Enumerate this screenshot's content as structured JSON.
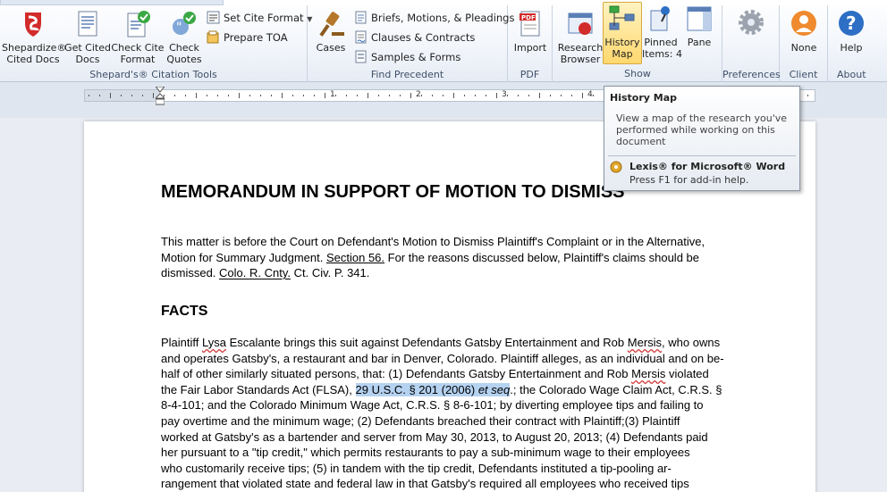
{
  "ribbon": {
    "groups": {
      "citation_tools": "Shepard's® Citation Tools",
      "find_precedent": "Find Precedent",
      "pdf": "PDF",
      "show": "Show",
      "preferences": "Preferences",
      "client": "Client",
      "about": "About"
    },
    "buttons": {
      "shepardize": [
        "Shepardize®",
        "Cited Docs"
      ],
      "get_cited": [
        "Get Cited",
        "Docs"
      ],
      "check_cite": [
        "Check Cite",
        "Format"
      ],
      "check_quotes": [
        "Check",
        "Quotes"
      ],
      "set_cite_format": "Set Cite Format",
      "prepare_toa": "Prepare TOA",
      "cases": "Cases",
      "briefs": "Briefs, Motions, & Pleadings",
      "clauses": "Clauses & Contracts",
      "samples": "Samples & Forms",
      "import": "Import",
      "research_browser": [
        "Research",
        "Browser"
      ],
      "history_map": [
        "History",
        "Map"
      ],
      "pinned_items": [
        "Pinned",
        "Items: 4"
      ],
      "pane": "Pane",
      "none": "None",
      "help": "Help"
    },
    "icons": {
      "shepardize": "shepard-signal-icon",
      "get_cited": "document-icon",
      "check_cite": "document-check-icon",
      "check_quotes": "quotes-check-icon",
      "set_cite_format": "format-list-icon",
      "prepare_toa": "toa-icon",
      "cases": "gavel-icon",
      "briefs": "brief-document-icon",
      "clauses": "contract-icon",
      "samples": "forms-icon",
      "import": "pdf-icon",
      "research_browser": "browser-icon",
      "history_map": "history-map-icon",
      "pinned_items": "pin-icon",
      "pane": "pane-icon",
      "preferences": "gear-icon",
      "none": "client-person-icon",
      "help": "help-icon"
    },
    "accent_colors": {
      "active_button": "#ffd86e",
      "help_blue": "#2d6fc4",
      "client_orange": "#ef8a2f"
    }
  },
  "ruler": {
    "numbers": [
      "1",
      "2",
      "3",
      "4",
      "5"
    ]
  },
  "tooltip": {
    "title": "History Map",
    "description": "View a map of the research you've performed while working on this document",
    "product": "Lexis® for Microsoft® Word",
    "help": "Press F1 for add-in help."
  },
  "document": {
    "title": "MEMORANDUM IN SUPPORT OF MOTION TO DISMISS",
    "intro": {
      "l1": "This matter is before the Court on Defendant's Motion to Dismiss Plaintiff's Complaint or in the Alternative,",
      "l2a": "Motion for Summary Judgment. ",
      "l2b": "Section 56.",
      "l2c": " For the reasons discussed below, Plaintiff's claims should be",
      "l3a": "dismissed. ",
      "l3b": "Colo. R. Cnty.",
      "l3c": " Ct. Civ. P. 341."
    },
    "facts_heading": "FACTS",
    "facts": {
      "l1a": "Plaintiff ",
      "l1b": "Lysa",
      "l1c": " Escalante brings this suit against Defendants Gatsby Entertainment and Rob ",
      "l1d": "Mersis",
      "l1e": ", who owns",
      "l2": "and operates Gatsby's, a restaurant and bar in Denver, Colorado. Plaintiff alleges, as an individual and on be-",
      "l3a": "half of other similarly situated persons, that: (1) Defendants Gatsby Entertainment and Rob ",
      "l3b": "Mersis",
      "l3c": " violated",
      "l4a": "the Fair Labor Standards Act (FLSA), ",
      "l4b": "29 U.S.C. § 201 (2006) ",
      "l4c": "et seq",
      "l4d": ".",
      "l4e": "; the Colorado Wage Claim Act, C.R.S. §",
      "l5": "8-4-101; and the Colorado Minimum Wage Act, C.R.S. § 8-6-101;  by diverting employee tips and failing to",
      "l6": "pay overtime and the minimum wage; (2) Defendants breached their contract with Plaintiff;(3) Plaintiff",
      "l7": "worked at Gatsby's as a bartender and server from May 30, 2013,  to August 20, 2013;  (4) Defendants paid",
      "l8": "her pursuant to a \"tip credit,\" which permits restaurants to pay a sub-minimum wage to their employees",
      "l9": "who customarily receive tips; (5) in tandem with the tip credit, Defendants instituted a tip-pooling ar-",
      "l10": "rangement that violated state and federal law in that Gatsby's required all employees who received tips"
    }
  }
}
